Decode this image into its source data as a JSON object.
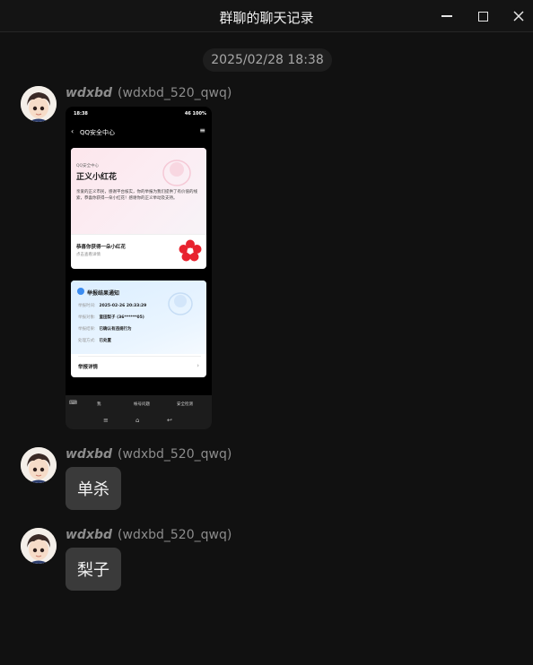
{
  "window": {
    "title": "群聊的聊天记录"
  },
  "timestamp": "2025/02/28 18:38",
  "messages": [
    {
      "nickname": "wdxbd",
      "qq": "(wdxbd_520_qwq)",
      "screenshot": {
        "status_time": "18:38",
        "status_right": "46 100%",
        "nav_title": "QQ安全中心",
        "card1": {
          "small": "QQ安全中心",
          "title": "正义小红花",
          "body": "亲爱的正义市民，感谢平台核实，你的举报为我们提供了有价值的线索，恭喜你获得一朵小红花！感谢你的正义举动及支持。",
          "footer_title": "恭喜你获得一朵小红花",
          "footer_sub": "点击查看详情"
        },
        "card2": {
          "title": "举报结果通知",
          "rows": [
            {
              "label": "举报时间:",
              "value": "2025-02-26 20:33:29"
            },
            {
              "label": "举报对象:",
              "value": "蛮田梨子 (36******05)"
            },
            {
              "label": "举报结果:",
              "value": "已确认有违规行为"
            },
            {
              "label": "处理方式:",
              "value": "已处置"
            }
          ],
          "detail": "举报详情"
        },
        "bottom_tabs": [
          "我",
          "帐号问题",
          "安全检测"
        ]
      }
    },
    {
      "nickname": "wdxbd",
      "qq": "(wdxbd_520_qwq)",
      "text": "单杀"
    },
    {
      "nickname": "wdxbd",
      "qq": "(wdxbd_520_qwq)",
      "text": "梨子"
    }
  ],
  "colors": {
    "background": "#111111",
    "bubble": "#3a3a3a",
    "name": "#8c8c8c",
    "flower": "#e8232f"
  }
}
